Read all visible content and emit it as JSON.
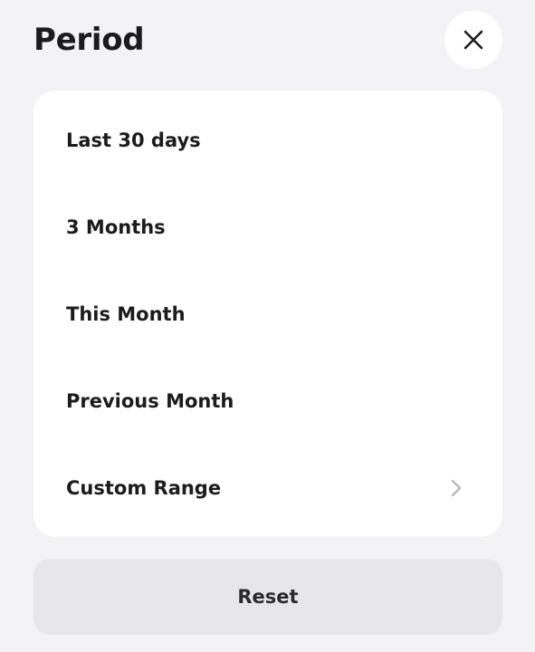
{
  "header": {
    "title": "Period",
    "close_icon": "close-icon"
  },
  "options": [
    {
      "label": "Last 30 days",
      "has_chevron": false
    },
    {
      "label": "3 Months",
      "has_chevron": false
    },
    {
      "label": "This Month",
      "has_chevron": false
    },
    {
      "label": "Previous Month",
      "has_chevron": false
    },
    {
      "label": "Custom Range",
      "has_chevron": true,
      "chevron_icon": "chevron-right-icon"
    }
  ],
  "footer": {
    "reset_label": "Reset"
  },
  "colors": {
    "background": "#f3f3f5",
    "card": "#ffffff",
    "reset_button": "#e7e7ea",
    "text": "#1c1c1e",
    "chevron": "#b0b0b5"
  }
}
